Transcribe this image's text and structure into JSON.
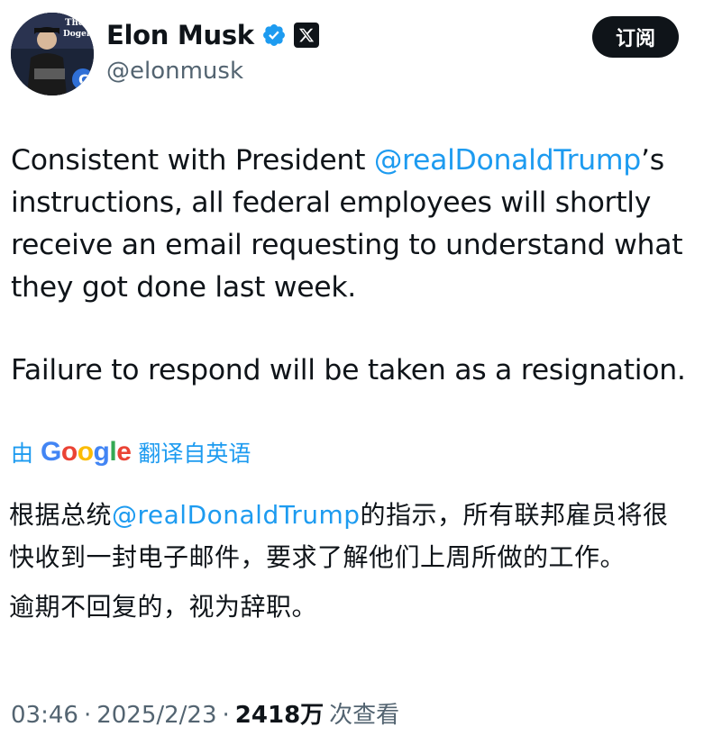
{
  "author": {
    "name": "Elon Musk",
    "handle": "@elonmusk",
    "avatar_text_1": "The",
    "avatar_text_2": "Dogefa"
  },
  "header": {
    "subscribe_label": "订阅"
  },
  "post": {
    "p1_before": "Consistent with President ",
    "p1_mention": "@realDonaldTrump",
    "p1_after": "’s instructions, all federal employees will shortly receive an email requesting to understand what they got done last week.",
    "p2": "Failure to respond will be taken as a resignation."
  },
  "translation": {
    "prefix": "由",
    "provider": "Google",
    "suffix": "翻译自英语",
    "p1_before": "根据总统",
    "p1_mention": "@realDonaldTrump",
    "p1_after": "的指示，所有联邦雇员将很快收到一封电子邮件，要求了解他们上周所做的工作。",
    "p2": "逾期不回复的，视为辞职。"
  },
  "meta": {
    "time": "03:46",
    "sep1": "·",
    "date": "2025/2/23",
    "sep2": "·",
    "views": "2418万",
    "views_label": "次查看"
  },
  "colors": {
    "link": "#1d9bf0",
    "muted": "#536471",
    "text": "#0f1419"
  },
  "icons": {
    "verified": "verified-badge-icon",
    "x_badge": "x-logo-icon"
  }
}
